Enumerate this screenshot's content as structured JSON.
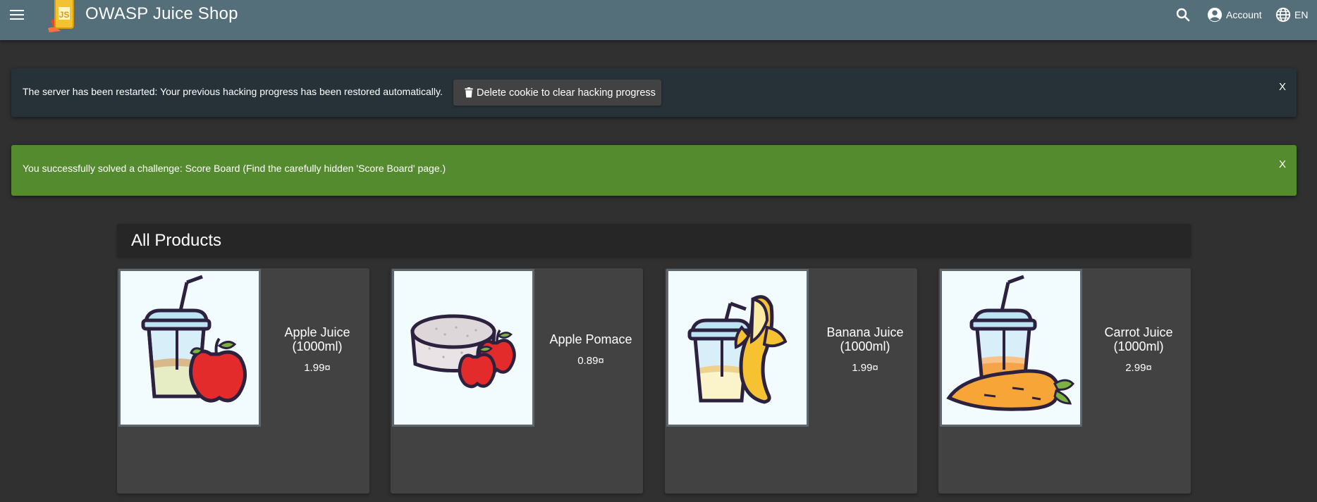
{
  "header": {
    "app_title": "OWASP Juice Shop",
    "logo_text": "JS",
    "account_label": "Account",
    "language_label": "EN",
    "toolbar_color": "#546e7a"
  },
  "notices": {
    "restart": {
      "text": "The server has been restarted: Your previous hacking progress has been restored automatically.",
      "button_label": "Delete cookie to clear hacking progress",
      "close_label": "X",
      "color": "#263238"
    },
    "solved": {
      "text": "You successfully solved a challenge: Score Board (Find the carefully hidden 'Score Board' page.)",
      "close_label": "X",
      "color": "#558b2f"
    }
  },
  "products": {
    "heading": "All Products",
    "items": [
      {
        "name": "Apple Juice (1000ml)",
        "price": "1.99¤",
        "image_icon": "apple-juice-icon"
      },
      {
        "name": "Apple Pomace",
        "price": "0.89¤",
        "image_icon": "apple-pomace-icon"
      },
      {
        "name": "Banana Juice (1000ml)",
        "price": "1.99¤",
        "image_icon": "banana-juice-icon"
      },
      {
        "name": "Carrot Juice (1000ml)",
        "price": "2.99¤",
        "image_icon": "carrot-juice-icon"
      }
    ]
  }
}
